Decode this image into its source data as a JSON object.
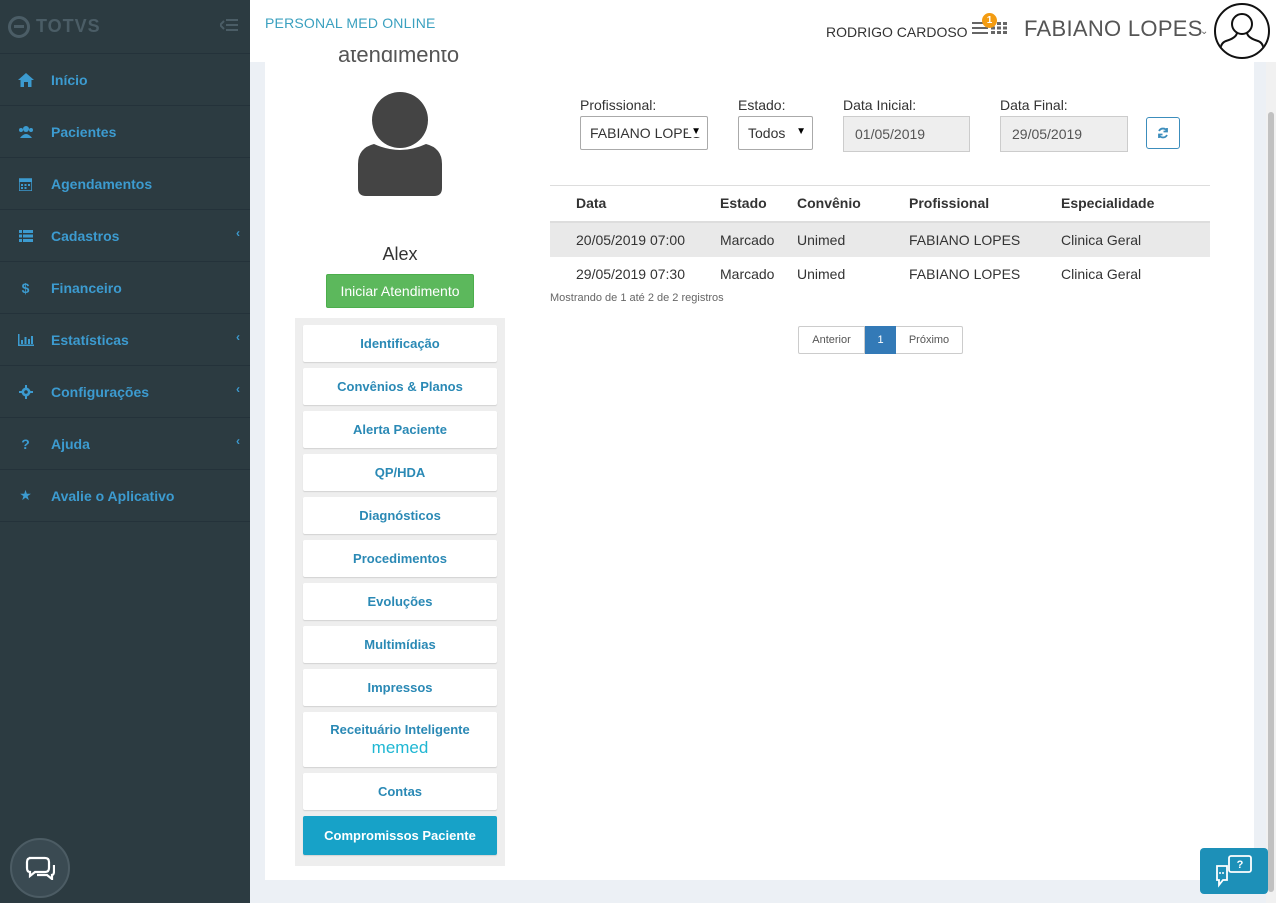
{
  "sidebar": {
    "logo_text": "TOTVS",
    "items": [
      {
        "label": "Início",
        "icon": "home-icon"
      },
      {
        "label": "Pacientes",
        "icon": "users-icon"
      },
      {
        "label": "Agendamentos",
        "icon": "calendar-icon"
      },
      {
        "label": "Cadastros",
        "icon": "list-icon"
      },
      {
        "label": "Financeiro",
        "icon": "dollar-icon"
      },
      {
        "label": "Estatísticas",
        "icon": "bar-chart-icon"
      },
      {
        "label": "Configurações",
        "icon": "gear-icon"
      },
      {
        "label": "Ajuda",
        "icon": "question-icon"
      },
      {
        "label": "Avalie o Aplicativo",
        "icon": "star-icon"
      }
    ]
  },
  "header": {
    "app_title": "PERSONAL MED ONLINE",
    "secondary_user": "RODRIGO CARDOSO",
    "notification_count": "1",
    "main_user": "FABIANO LOPES"
  },
  "patient": {
    "heading_partial": "atendimento",
    "name": "Alex",
    "start_button": "Iniciar Atendimento"
  },
  "menu": {
    "identificacao": "Identificação",
    "convenios": "Convênios & Planos",
    "alerta": "Alerta Paciente",
    "qphda": "QP/HDA",
    "diagnosticos": "Diagnósticos",
    "procedimentos": "Procedimentos",
    "evolucoes": "Evoluções",
    "multimidias": "Multimídias",
    "impressos": "Impressos",
    "receituario": "Receituário Inteligente",
    "memed": "memed",
    "contas": "Contas",
    "compromissos": "Compromissos Paciente"
  },
  "filters": {
    "profissional_label": "Profissional:",
    "profissional_value": "FABIANO LOPES",
    "estado_label": "Estado:",
    "estado_value": "Todos",
    "data_inicial_label": "Data Inicial:",
    "data_inicial_value": "01/05/2019",
    "data_final_label": "Data Final:",
    "data_final_value": "29/05/2019"
  },
  "table": {
    "headers": [
      "Data",
      "Estado",
      "Convênio",
      "Profissional",
      "Especialidade"
    ],
    "rows": [
      [
        "20/05/2019 07:00",
        "Marcado",
        "Unimed",
        "FABIANO LOPES",
        "Clinica Geral"
      ],
      [
        "29/05/2019 07:30",
        "Marcado",
        "Unimed",
        "FABIANO LOPES",
        "Clinica Geral"
      ]
    ],
    "info": "Mostrando de 1 até 2 de 2 registros"
  },
  "pagination": {
    "prev": "Anterior",
    "current": "1",
    "next": "Próximo"
  },
  "colors": {
    "sidebar_bg": "#2c3b41",
    "accent": "#3c9bd0",
    "success": "#5cb85c",
    "active_menu": "#17a2c8"
  }
}
